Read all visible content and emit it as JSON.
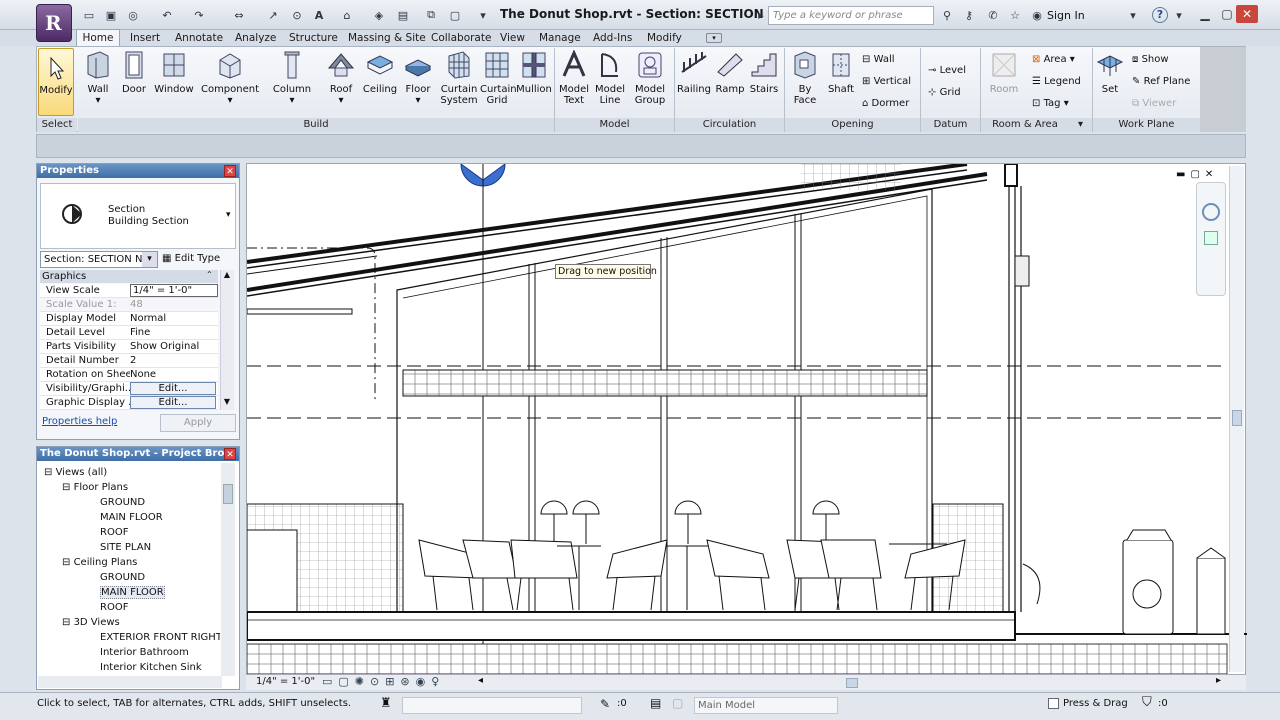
{
  "app": {
    "logo_letter": "R",
    "title": "The Donut Shop.rvt - Section: SECTION ...",
    "search_placeholder": "Type a keyword or phrase",
    "signin": "Sign In",
    "help": "?"
  },
  "tabs": [
    "Home",
    "Insert",
    "Annotate",
    "Analyze",
    "Structure",
    "Massing & Site",
    "Collaborate",
    "View",
    "Manage",
    "Add-Ins",
    "Modify"
  ],
  "ribbon": {
    "select": {
      "modify": "Modify",
      "label": "Select"
    },
    "build": {
      "label": "Build",
      "buttons": [
        "Wall",
        "Door",
        "Window",
        "Component",
        "Column",
        "Roof",
        "Ceiling",
        "Floor"
      ],
      "curtain_system": [
        "Curtain",
        "System"
      ],
      "curtain_grid": [
        "Curtain",
        "Grid"
      ],
      "mullion": "Mullion"
    },
    "model": {
      "label": "Model",
      "model_text": [
        "Model",
        "Text"
      ],
      "model_line": [
        "Model",
        "Line"
      ],
      "model_group": [
        "Model",
        "Group"
      ]
    },
    "circulation": {
      "label": "Circulation",
      "buttons": [
        "Railing",
        "Ramp",
        "Stairs"
      ]
    },
    "opening": {
      "label": "Opening",
      "by_face": [
        "By",
        "Face"
      ],
      "shaft": "Shaft",
      "small": [
        "Wall",
        "Vertical",
        "Dormer"
      ]
    },
    "datum": {
      "label": "Datum",
      "level": "Level",
      "grid": "Grid"
    },
    "room_area": {
      "label": "Room & Area",
      "room": "Room",
      "area": "Area",
      "legend": "Legend",
      "tag": "Tag"
    },
    "work_plane": {
      "label": "Work Plane",
      "set": "Set",
      "show": "Show",
      "ref_plane": "Ref Plane",
      "viewer": "Viewer"
    }
  },
  "properties": {
    "title": "Properties",
    "type_line1": "Section",
    "type_line2": "Building Section",
    "selector": "Section: SECTION N(",
    "edit_type": "Edit Type",
    "group": "Graphics",
    "rows": [
      {
        "k": "View Scale",
        "v": "1/4\" = 1'-0\""
      },
      {
        "k": "Scale Value    1:",
        "v": "48"
      },
      {
        "k": "Display Model",
        "v": "Normal"
      },
      {
        "k": "Detail Level",
        "v": "Fine"
      },
      {
        "k": "Parts Visibility",
        "v": "Show Original"
      },
      {
        "k": "Detail Number",
        "v": "2"
      },
      {
        "k": "Rotation on Sheet",
        "v": "None"
      },
      {
        "k": "Visibility/Graphi...",
        "v": "Edit..."
      },
      {
        "k": "Graphic Display ...",
        "v": "Edit..."
      }
    ],
    "help": "Properties help",
    "apply": "Apply"
  },
  "browser": {
    "title": "The Donut Shop.rvt - Project Bro...",
    "nodes": [
      {
        "label": "Views (all)",
        "level": 0
      },
      {
        "label": "Floor Plans",
        "level": 1
      },
      {
        "label": "GROUND",
        "level": 2
      },
      {
        "label": "MAIN FLOOR",
        "level": 2
      },
      {
        "label": "ROOF",
        "level": 2
      },
      {
        "label": "SITE PLAN",
        "level": 2
      },
      {
        "label": "Ceiling Plans",
        "level": 1
      },
      {
        "label": "GROUND",
        "level": 2
      },
      {
        "label": "MAIN FLOOR",
        "level": 2,
        "selected": true
      },
      {
        "label": "ROOF",
        "level": 2
      },
      {
        "label": "3D Views",
        "level": 1
      },
      {
        "label": "EXTERIOR FRONT RIGHT",
        "level": 2
      },
      {
        "label": "Interior Bathroom",
        "level": 2
      },
      {
        "label": "Interior Kitchen Sink",
        "level": 2
      }
    ]
  },
  "canvas": {
    "tooltip": "Drag to new position"
  },
  "viewbar": {
    "scale": "1/4\" = 1'-0\""
  },
  "status": {
    "hint": "Click to select, TAB for alternates, CTRL adds, SHIFT unselects.",
    "count": ":0",
    "model": "Main Model",
    "press_drag": "Press & Drag",
    "filter": ":0"
  }
}
